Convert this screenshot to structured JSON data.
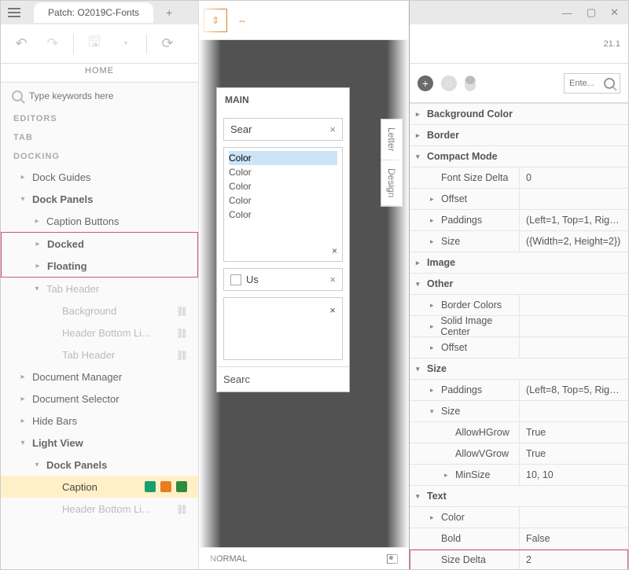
{
  "tab_title": "Patch: O2019C-Fonts",
  "home_label": "HOME",
  "version_label": "21.1",
  "search_placeholder": "Type keywords here",
  "headings": {
    "editors": "EDITORS",
    "tab": "TAB",
    "docking": "DOCKING"
  },
  "tree": {
    "dock_guides": "Dock Guides",
    "dock_panels": "Dock Panels",
    "caption_buttons": "Caption Buttons",
    "docked": "Docked",
    "floating": "Floating",
    "tab_header": "Tab Header",
    "background": "Background",
    "header_bottom": "Header Bottom Li...",
    "tab_header_leaf": "Tab Header",
    "doc_manager": "Document Manager",
    "doc_selector": "Document Selector",
    "hide_bars": "Hide Bars",
    "light_view": "Light View",
    "lv_dock_panels": "Dock Panels",
    "caption": "Caption",
    "lv_header_bottom": "Header Bottom Li..."
  },
  "mid": {
    "title": "MAIN",
    "search_field": "Sear",
    "list": [
      "Color",
      "Color",
      "Color",
      "Color",
      "Color"
    ],
    "use_label": "Us",
    "footer": "Searc",
    "side_tabs": [
      "Letter",
      "Design"
    ],
    "status_left": "NORMAL"
  },
  "right": {
    "search_ph": "Ente...",
    "groups": {
      "bg_color": "Background Color",
      "border": "Border",
      "compact": "Compact Mode",
      "image": "Image",
      "other": "Other",
      "size": "Size",
      "text": "Text"
    },
    "props": {
      "font_size_delta": "Font Size Delta",
      "font_size_delta_v": "0",
      "offset": "Offset",
      "paddings": "Paddings",
      "paddings_cm_v": "(Left=1, Top=1, Right...",
      "size_cm": "Size",
      "size_cm_v": "({Width=2, Height=2})",
      "border_colors": "Border Colors",
      "solid_image_center": "Solid Image Center",
      "paddings_sz_v": "(Left=8, Top=5, Right...",
      "allow_h": "AllowHGrow",
      "true": "True",
      "allow_v": "AllowVGrow",
      "minsize": "MinSize",
      "minsize_v": "10, 10",
      "color": "Color",
      "bold": "Bold",
      "false": "False",
      "size_delta": "Size Delta",
      "size_delta_v": "2"
    }
  }
}
